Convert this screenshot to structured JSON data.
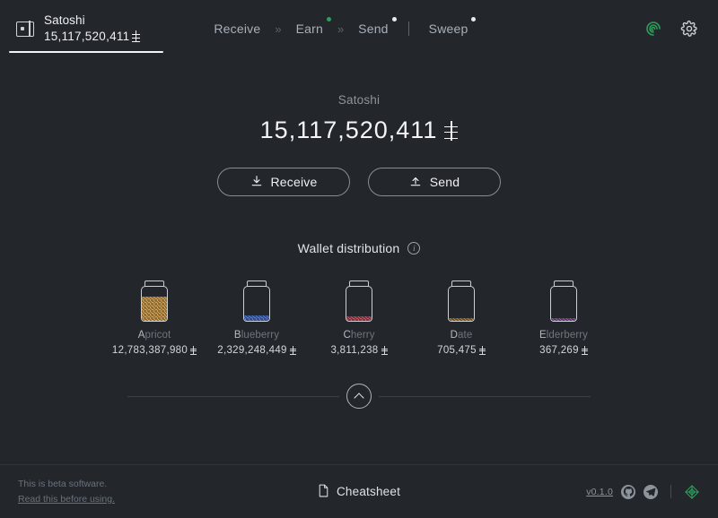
{
  "theme": {
    "background": "#23272c",
    "text_primary": "#eef0f2",
    "text_muted": "#8d949c",
    "accent_green": "#2e9e5b",
    "border": "#868d95"
  },
  "topbar": {
    "wallet_icon": "wallet-icon",
    "wallet_name": "Satoshi",
    "wallet_balance": "15,117,520,411",
    "currency_symbol": "ERG",
    "nav": [
      {
        "label": "Receive",
        "badge": null
      },
      {
        "label": "Earn",
        "badge": "#2e9e5b"
      },
      {
        "label": "Send",
        "badge": "#e9ecef"
      },
      {
        "label": "Sweep",
        "badge": "#e9ecef"
      }
    ],
    "nav_separator": "»",
    "ergo_icon": "ergo-logo-icon",
    "settings_icon": "gear-icon"
  },
  "main": {
    "account_label": "Satoshi",
    "balance": "15,117,520,411",
    "receive_button": "Receive",
    "send_button": "Send",
    "receive_icon": "download-arrow-icon",
    "send_icon": "upload-arrow-icon",
    "distribution_title": "Wallet distribution",
    "info_icon": "info-icon",
    "info_glyph": "i"
  },
  "chart_data": {
    "type": "bar",
    "title": "Wallet distribution",
    "xlabel": "",
    "ylabel": "",
    "categories": [
      "Apricot",
      "Blueberry",
      "Cherry",
      "Date",
      "Elderberry"
    ],
    "values": [
      12783387980,
      2329248449,
      3811238,
      705475,
      367269
    ],
    "value_labels": [
      "12,783,387,980",
      "2,329,248,449",
      "3,811,238",
      "705,475",
      "367,269"
    ],
    "fill_percent": [
      72,
      16,
      13,
      7,
      9
    ],
    "colors": [
      "#c9953f",
      "#3a63c0",
      "#b4384a",
      "#9a6a23",
      "#7a3f8c"
    ],
    "unit": "ERG",
    "grid": false,
    "legend": "none"
  },
  "jars": [
    {
      "name": "Apricot",
      "initial": "A",
      "rest": "pricot",
      "amount": "12,783,387,980",
      "color": "#c9953f",
      "fill_percent": 72
    },
    {
      "name": "Blueberry",
      "initial": "B",
      "rest": "lueberry",
      "amount": "2,329,248,449",
      "color": "#3a63c0",
      "fill_percent": 16
    },
    {
      "name": "Cherry",
      "initial": "C",
      "rest": "herry",
      "amount": "3,811,238",
      "color": "#b4384a",
      "fill_percent": 13
    },
    {
      "name": "Date",
      "initial": "D",
      "rest": "ate",
      "amount": "705,475",
      "color": "#9a6a23",
      "fill_percent": 7
    },
    {
      "name": "Elderberry",
      "initial": "E",
      "rest": "lderberry",
      "amount": "367,269",
      "color": "#7a3f8c",
      "fill_percent": 9
    }
  ],
  "collapse": {
    "icon": "chevron-up-icon"
  },
  "footer": {
    "beta_notice": "This is beta software.",
    "beta_link": "Read this before using.",
    "cheatsheet_label": "Cheatsheet",
    "cheatsheet_icon": "document-icon",
    "version": "v0.1.0",
    "github_icon": "github-icon",
    "telegram_icon": "telegram-icon",
    "ergo_icon": "ergo-logo-icon"
  }
}
